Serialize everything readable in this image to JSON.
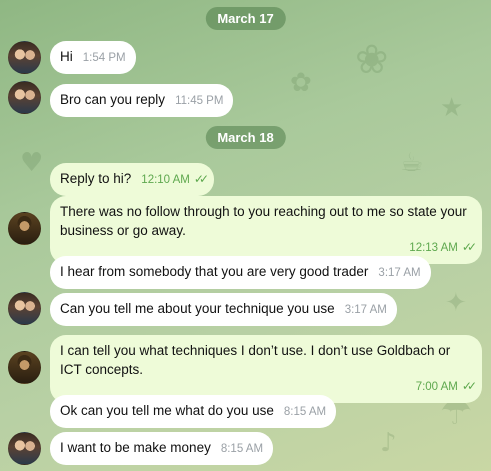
{
  "dates": [
    "March 17",
    "March 18"
  ],
  "colors": {
    "incoming_bubble": "#ffffff",
    "outgoing_bubble": "#eefbd8",
    "read_check": "#5ea84e",
    "date_pill": "#5a8a52"
  },
  "messages": [
    {
      "text": "Hi",
      "time": "1:54 PM",
      "from": "contact",
      "avatar": "couple-photo"
    },
    {
      "text": "Bro can you reply",
      "time": "11:45 PM",
      "from": "contact",
      "avatar": "couple-photo"
    },
    {
      "text": "Reply to hi?",
      "time": "12:10 AM",
      "from": "me",
      "read": true
    },
    {
      "text": "There was no follow through to you reaching out to me so state your business or go away.",
      "time": "12:13 AM",
      "from": "me",
      "read": true,
      "avatar": "man-photo"
    },
    {
      "text": "I hear from somebody that you are very good trader",
      "time": "3:17 AM",
      "from": "contact"
    },
    {
      "text": "Can you tell me about your technique you use",
      "time": "3:17 AM",
      "from": "contact",
      "avatar": "couple-photo"
    },
    {
      "text": "I can tell you what techniques I don’t use. I don’t use Goldbach or ICT concepts.",
      "time": "7:00 AM",
      "from": "me",
      "read": true,
      "avatar": "man-photo"
    },
    {
      "text": "Ok can you tell me what do you use",
      "time": "8:15 AM",
      "from": "contact"
    },
    {
      "text": "I want to be make money",
      "time": "8:15 AM",
      "from": "contact",
      "avatar": "couple-photo"
    }
  ]
}
